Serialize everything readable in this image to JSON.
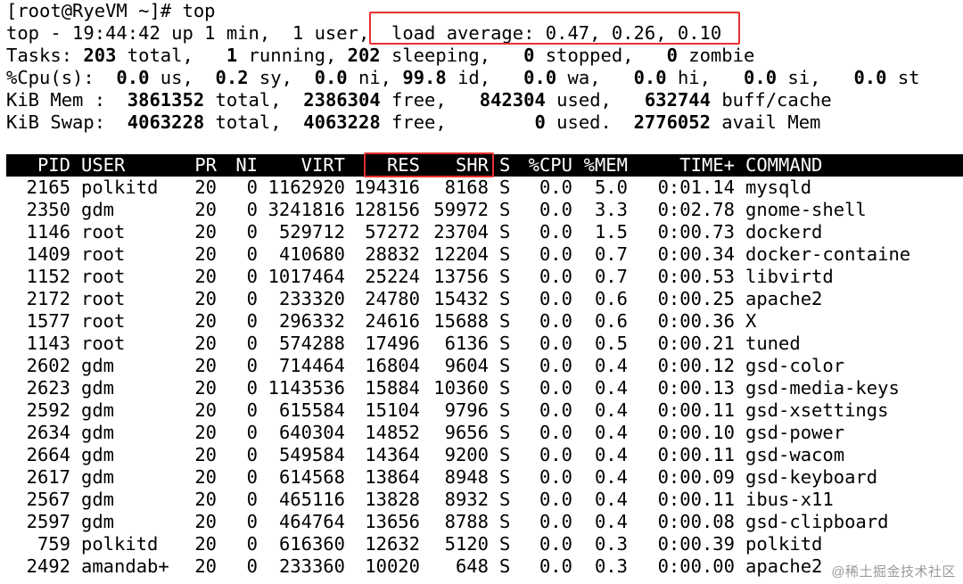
{
  "summary": {
    "prompt": "[root@RyeVM ~]# top",
    "line1_pre": "top - 19:44:42 up 1 min,  1 user,  ",
    "line1_load": "load average: 0.47, 0.26, 0.10",
    "tasks": {
      "label": "Tasks: ",
      "total": "203",
      "total_label": " total,   ",
      "running": "1",
      "running_label": " running, ",
      "sleeping": "202",
      "sleeping_label": " sleeping,   ",
      "stopped": "0",
      "stopped_label": " stopped,   ",
      "zombie": "0",
      "zombie_label": " zombie"
    },
    "cpu": {
      "label": "%Cpu(s):  ",
      "us": "0.0",
      "us_label": " us,  ",
      "sy": "0.2",
      "sy_label": " sy,  ",
      "ni": "0.0",
      "ni_label": " ni, ",
      "id": "99.8",
      "id_label": " id,   ",
      "wa": "0.0",
      "wa_label": " wa,   ",
      "hi": "0.0",
      "hi_label": " hi,   ",
      "si": "0.0",
      "si_label": " si,   ",
      "st": "0.0",
      "st_label": " st"
    },
    "mem": {
      "label": "KiB Mem :  ",
      "total": "3861352",
      "total_label": " total,  ",
      "free": "2386304",
      "free_label": " free,   ",
      "used": "842304",
      "used_label": " used,   ",
      "buff": "632744",
      "buff_label": " buff/cache"
    },
    "swap": {
      "label": "KiB Swap:  ",
      "total": "4063228",
      "total_label": " total,  ",
      "free": "4063228",
      "free_label": " free,        ",
      "used": "0",
      "used_label": " used.  ",
      "avail": "2776052",
      "avail_label": " avail Mem"
    }
  },
  "columns": {
    "pid": "PID",
    "user": "USER",
    "pr": "PR",
    "ni": "NI",
    "virt": "VIRT",
    "res": "RES",
    "shr": "SHR",
    "s": "S",
    "cpu": "%CPU",
    "mem": "%MEM",
    "time": "TIME+",
    "cmd": "COMMAND"
  },
  "processes": [
    {
      "pid": "2165",
      "user": "polkitd",
      "pr": "20",
      "ni": "0",
      "virt": "1162920",
      "res": "194316",
      "shr": "8168",
      "s": "S",
      "cpu": "0.0",
      "mem": "5.0",
      "time": "0:01.14",
      "cmd": "mysqld"
    },
    {
      "pid": "2350",
      "user": "gdm",
      "pr": "20",
      "ni": "0",
      "virt": "3241816",
      "res": "128156",
      "shr": "59972",
      "s": "S",
      "cpu": "0.0",
      "mem": "3.3",
      "time": "0:02.78",
      "cmd": "gnome-shell"
    },
    {
      "pid": "1146",
      "user": "root",
      "pr": "20",
      "ni": "0",
      "virt": "529712",
      "res": "57272",
      "shr": "23704",
      "s": "S",
      "cpu": "0.0",
      "mem": "1.5",
      "time": "0:00.73",
      "cmd": "dockerd"
    },
    {
      "pid": "1409",
      "user": "root",
      "pr": "20",
      "ni": "0",
      "virt": "410680",
      "res": "28832",
      "shr": "12204",
      "s": "S",
      "cpu": "0.0",
      "mem": "0.7",
      "time": "0:00.34",
      "cmd": "docker-containe"
    },
    {
      "pid": "1152",
      "user": "root",
      "pr": "20",
      "ni": "0",
      "virt": "1017464",
      "res": "25224",
      "shr": "13756",
      "s": "S",
      "cpu": "0.0",
      "mem": "0.7",
      "time": "0:00.53",
      "cmd": "libvirtd"
    },
    {
      "pid": "2172",
      "user": "root",
      "pr": "20",
      "ni": "0",
      "virt": "233320",
      "res": "24780",
      "shr": "15432",
      "s": "S",
      "cpu": "0.0",
      "mem": "0.6",
      "time": "0:00.25",
      "cmd": "apache2"
    },
    {
      "pid": "1577",
      "user": "root",
      "pr": "20",
      "ni": "0",
      "virt": "296332",
      "res": "24616",
      "shr": "15688",
      "s": "S",
      "cpu": "0.0",
      "mem": "0.6",
      "time": "0:00.36",
      "cmd": "X"
    },
    {
      "pid": "1143",
      "user": "root",
      "pr": "20",
      "ni": "0",
      "virt": "574288",
      "res": "17496",
      "shr": "6136",
      "s": "S",
      "cpu": "0.0",
      "mem": "0.5",
      "time": "0:00.21",
      "cmd": "tuned"
    },
    {
      "pid": "2602",
      "user": "gdm",
      "pr": "20",
      "ni": "0",
      "virt": "714464",
      "res": "16804",
      "shr": "9604",
      "s": "S",
      "cpu": "0.0",
      "mem": "0.4",
      "time": "0:00.12",
      "cmd": "gsd-color"
    },
    {
      "pid": "2623",
      "user": "gdm",
      "pr": "20",
      "ni": "0",
      "virt": "1143536",
      "res": "15884",
      "shr": "10360",
      "s": "S",
      "cpu": "0.0",
      "mem": "0.4",
      "time": "0:00.13",
      "cmd": "gsd-media-keys"
    },
    {
      "pid": "2592",
      "user": "gdm",
      "pr": "20",
      "ni": "0",
      "virt": "615584",
      "res": "15104",
      "shr": "9796",
      "s": "S",
      "cpu": "0.0",
      "mem": "0.4",
      "time": "0:00.11",
      "cmd": "gsd-xsettings"
    },
    {
      "pid": "2634",
      "user": "gdm",
      "pr": "20",
      "ni": "0",
      "virt": "640304",
      "res": "14852",
      "shr": "9656",
      "s": "S",
      "cpu": "0.0",
      "mem": "0.4",
      "time": "0:00.10",
      "cmd": "gsd-power"
    },
    {
      "pid": "2664",
      "user": "gdm",
      "pr": "20",
      "ni": "0",
      "virt": "549584",
      "res": "14364",
      "shr": "9200",
      "s": "S",
      "cpu": "0.0",
      "mem": "0.4",
      "time": "0:00.11",
      "cmd": "gsd-wacom"
    },
    {
      "pid": "2617",
      "user": "gdm",
      "pr": "20",
      "ni": "0",
      "virt": "614568",
      "res": "13864",
      "shr": "8948",
      "s": "S",
      "cpu": "0.0",
      "mem": "0.4",
      "time": "0:00.09",
      "cmd": "gsd-keyboard"
    },
    {
      "pid": "2567",
      "user": "gdm",
      "pr": "20",
      "ni": "0",
      "virt": "465116",
      "res": "13828",
      "shr": "8932",
      "s": "S",
      "cpu": "0.0",
      "mem": "0.4",
      "time": "0:00.11",
      "cmd": "ibus-x11"
    },
    {
      "pid": "2597",
      "user": "gdm",
      "pr": "20",
      "ni": "0",
      "virt": "464764",
      "res": "13656",
      "shr": "8788",
      "s": "S",
      "cpu": "0.0",
      "mem": "0.4",
      "time": "0:00.08",
      "cmd": "gsd-clipboard"
    },
    {
      "pid": "759",
      "user": "polkitd",
      "pr": "20",
      "ni": "0",
      "virt": "616360",
      "res": "12632",
      "shr": "5120",
      "s": "S",
      "cpu": "0.0",
      "mem": "0.3",
      "time": "0:00.39",
      "cmd": "polkitd"
    },
    {
      "pid": "2492",
      "user": "amandab+",
      "pr": "20",
      "ni": "0",
      "virt": "233360",
      "res": "10020",
      "shr": "648",
      "s": "S",
      "cpu": "0.0",
      "mem": "0.3",
      "time": "0:00.00",
      "cmd": "apache2"
    }
  ],
  "watermark": "@稀土掘金技术社区",
  "colors": {
    "highlight": "#e8302f",
    "header_bg": "#000000",
    "header_fg": "#ffffff"
  }
}
